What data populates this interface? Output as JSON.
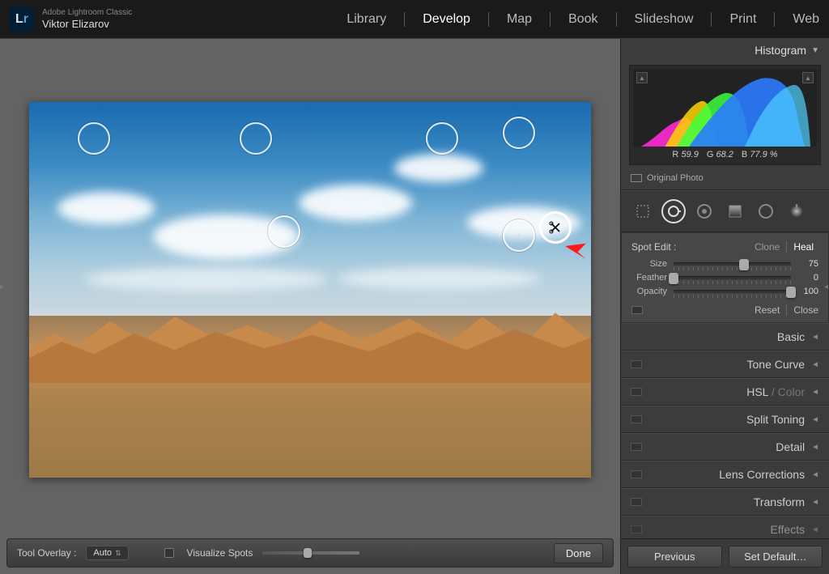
{
  "header": {
    "product": "Adobe Lightroom Classic",
    "user": "Viktor Elizarov",
    "logo_text_a": "L",
    "logo_text_b": "r"
  },
  "modules": {
    "library": "Library",
    "develop": "Develop",
    "map": "Map",
    "book": "Book",
    "slideshow": "Slideshow",
    "print": "Print",
    "web": "Web",
    "active": "Develop"
  },
  "histogram": {
    "title": "Histogram",
    "r_label": "R",
    "r_value": "59.9",
    "g_label": "G",
    "g_value": "68.2",
    "b_label": "B",
    "b_value": "77.9",
    "pct": "%",
    "original_label": "Original Photo"
  },
  "tools": {
    "crop": "crop-tool",
    "spot": "spot-removal-tool",
    "redeye": "redeye-tool",
    "gradient": "gradient-tool",
    "radial": "radial-tool",
    "brush": "adjustment-brush-tool"
  },
  "spot_panel": {
    "title": "Spot Edit :",
    "mode_clone": "Clone",
    "mode_heal": "Heal",
    "mode_active": "Heal",
    "size_label": "Size",
    "size_value": "75",
    "size_pct": 60,
    "feather_label": "Feather",
    "feather_value": "0",
    "feather_pct": 0,
    "opacity_label": "Opacity",
    "opacity_value": "100",
    "opacity_pct": 100,
    "reset": "Reset",
    "close": "Close"
  },
  "sections": {
    "basic": "Basic",
    "tone_curve": "Tone Curve",
    "hsl": "HSL",
    "color": "Color",
    "split_toning": "Split Toning",
    "detail": "Detail",
    "lens_corrections": "Lens Corrections",
    "transform": "Transform",
    "effects": "Effects"
  },
  "right_footer": {
    "previous": "Previous",
    "set_default": "Set Default…"
  },
  "bottom": {
    "tool_overlay_label": "Tool Overlay :",
    "tool_overlay_value": "Auto",
    "visualize_label": "Visualize Spots",
    "done": "Done"
  }
}
